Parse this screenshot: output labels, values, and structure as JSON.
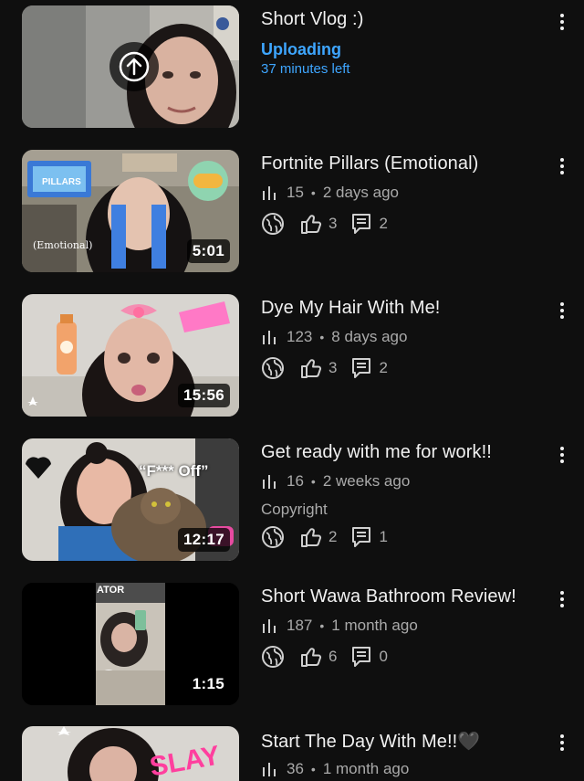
{
  "videos": [
    {
      "title": "Short Vlog :)",
      "status_label": "Uploading",
      "status_detail": "37 minutes left"
    },
    {
      "title": "Fortnite Pillars (Emotional)",
      "duration": "5:01",
      "views": "15",
      "age": "2 days ago",
      "visibility_icon": "globe-icon",
      "likes": "3",
      "comments": "2",
      "thumb_text_top": "PILLARS",
      "thumb_text_bottom": "(Emotional)"
    },
    {
      "title": "Dye My Hair With Me!",
      "duration": "15:56",
      "views": "123",
      "age": "8 days ago",
      "likes": "3",
      "comments": "2"
    },
    {
      "title": "Get ready with me for work!!",
      "duration": "12:17",
      "views": "16",
      "age": "2 weeks ago",
      "note": "Copyright",
      "likes": "2",
      "comments": "1",
      "thumb_text": "“F*** Off”"
    },
    {
      "title": "Short Wawa Bathroom Review!",
      "duration": "1:15",
      "views": "187",
      "age": "1 month ago",
      "likes": "6",
      "comments": "0",
      "thumb_text": "ATOR"
    },
    {
      "title": "Start The Day With Me!!🖤",
      "views": "36",
      "age": "1 month ago",
      "thumb_text": "SLAY"
    }
  ],
  "colors": {
    "background": "#0f0f0f",
    "accent_blue": "#3ea6ff",
    "secondary_text": "#aaaaaa"
  }
}
